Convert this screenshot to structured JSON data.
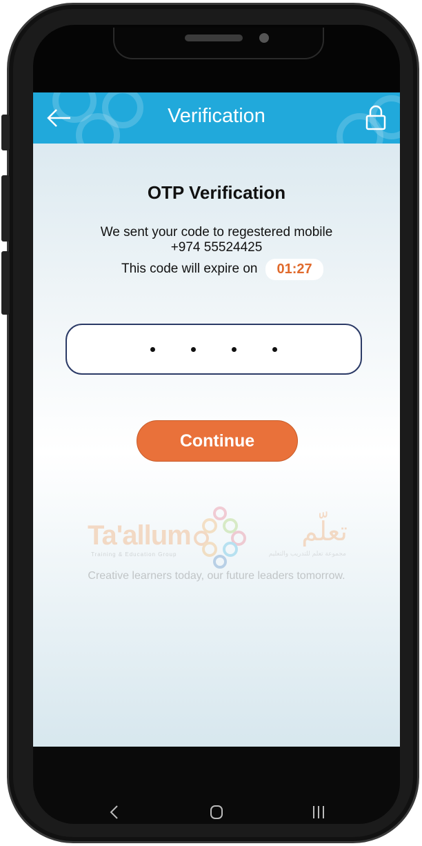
{
  "appbar": {
    "title": "Verification",
    "back_icon": "arrow-left-icon",
    "lock_icon": "lock-icon",
    "color": "#21a9db"
  },
  "otp": {
    "heading": "OTP Verification",
    "message_line1": "We sent your code to regestered mobile",
    "phone": "+974 55524425",
    "expire_label": "This code will expire on",
    "timer": "01:27",
    "digits_entered": 4
  },
  "continue_button": {
    "label": "Continue",
    "color": "#e9713a"
  },
  "branding": {
    "name_en": "Ta'allum",
    "name_ar": "تعلّم",
    "sub_en": "Training & Education Group",
    "sub_ar": "مجموعة تعلم للتدريب والتعليم",
    "tagline": "Creative learners today, our future leaders tomorrow."
  },
  "system_nav": {
    "back_icon": "nav-back-icon",
    "home_icon": "nav-home-icon",
    "recents_icon": "nav-recents-icon"
  }
}
